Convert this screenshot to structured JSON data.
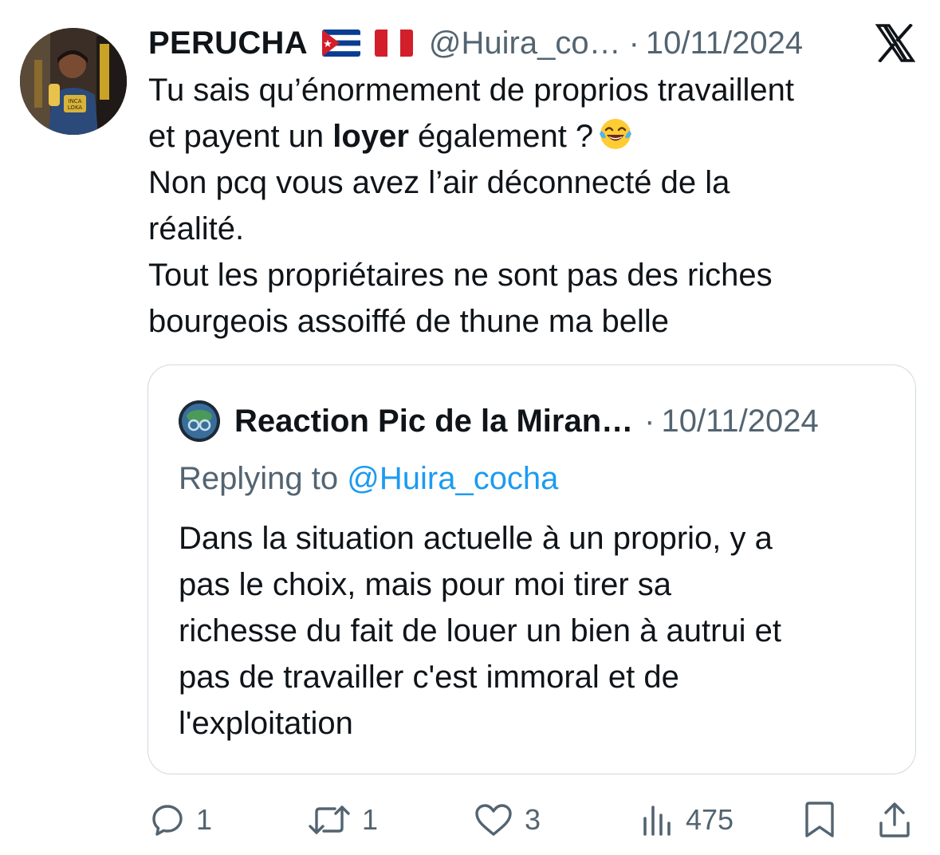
{
  "tweet": {
    "author_name": "PERUCHA",
    "flags": [
      "cuba-flag",
      "peru-flag"
    ],
    "handle": "@Huira_co…",
    "separator": "·",
    "date": "10/11/2024",
    "text_lines": [
      {
        "before": "Tu sais qu’énormement de proprios travaillent",
        "bold": "",
        "after": ""
      },
      {
        "before": "et payent un ",
        "bold": "loyer",
        "after": " également ?"
      },
      {
        "before": "Non pcq vous avez l’air déconnecté de la",
        "bold": "",
        "after": ""
      },
      {
        "before": "réalité.",
        "bold": "",
        "after": ""
      },
      {
        "before": "Tout les propriétaires ne sont pas des riches",
        "bold": "",
        "after": ""
      },
      {
        "before": "bourgeois assoiffé de thune ma belle",
        "bold": "",
        "after": ""
      }
    ],
    "emoji": "tears-of-joy-emoji"
  },
  "quoted_tweet": {
    "author_name": "Reaction Pic de la Miran…",
    "separator": "·",
    "date": "10/11/2024",
    "replying_label": "Replying to",
    "replying_mention": "@Huira_cocha",
    "text_lines": [
      "Dans la situation actuelle à un proprio, y a",
      "pas le choix, mais pour moi tirer sa",
      "richesse du fait de louer un bien à autrui et",
      "pas de travailler c'est immoral et de",
      "l'exploitation"
    ]
  },
  "actions": {
    "reply_count": "1",
    "retweet_count": "1",
    "like_count": "3",
    "views_count": "475"
  },
  "colors": {
    "text_primary": "#0f1419",
    "text_secondary": "#536471",
    "mention_blue": "#1d9bf0",
    "border": "#cfd9de"
  },
  "icons": {
    "brand": "x-logo-icon",
    "reply": "reply-icon",
    "retweet": "retweet-icon",
    "like": "heart-icon",
    "views": "views-icon",
    "bookmark": "bookmark-icon",
    "share": "share-icon"
  }
}
